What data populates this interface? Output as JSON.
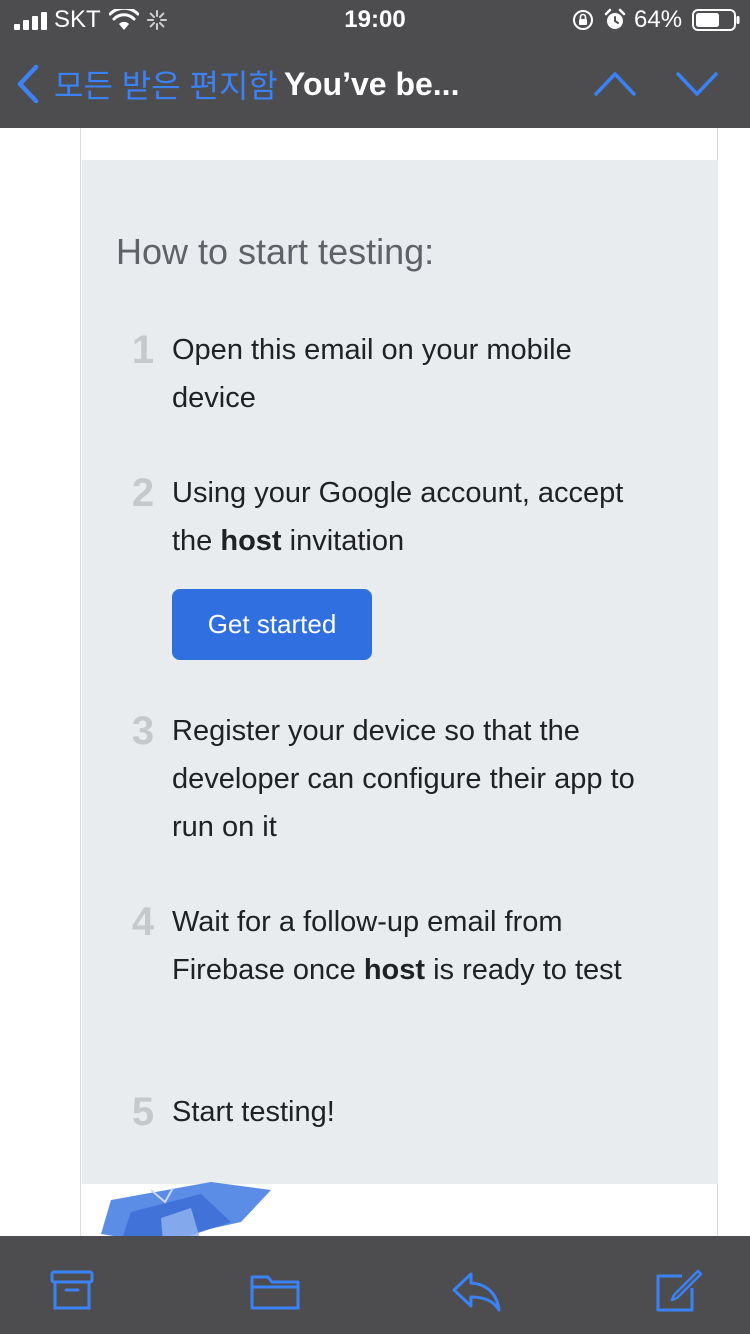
{
  "status_bar": {
    "carrier": "SKT",
    "time": "19:00",
    "battery_percent": "64%",
    "battery_level": 0.64
  },
  "nav": {
    "back_label": "모든 받은 편지함",
    "title": "You’ve be..."
  },
  "email": {
    "heading": "How to start testing:",
    "steps": [
      {
        "number": "1",
        "text": "Open this email on your mobile device"
      },
      {
        "number": "2",
        "text_before": "Using your Google account, accept the ",
        "bold": "host",
        "text_after": " invitation"
      },
      {
        "number": "3",
        "text": "Register your device so that the developer can configure their app to run on it"
      },
      {
        "number": "4",
        "text_before": "Wait for a follow-up email from Firebase once ",
        "bold": "host",
        "text_after": " is ready to test"
      },
      {
        "number": "5",
        "text": "Start testing!"
      }
    ],
    "cta_label": "Get started"
  },
  "toolbar": {
    "icons": [
      "archive-icon",
      "folder-icon",
      "reply-icon",
      "compose-icon"
    ]
  },
  "colors": {
    "bar_background": "#4d4d4f",
    "accent_blue": "#3b82f6",
    "card_background": "#e9ecef",
    "button_blue": "#2f6fe0"
  }
}
